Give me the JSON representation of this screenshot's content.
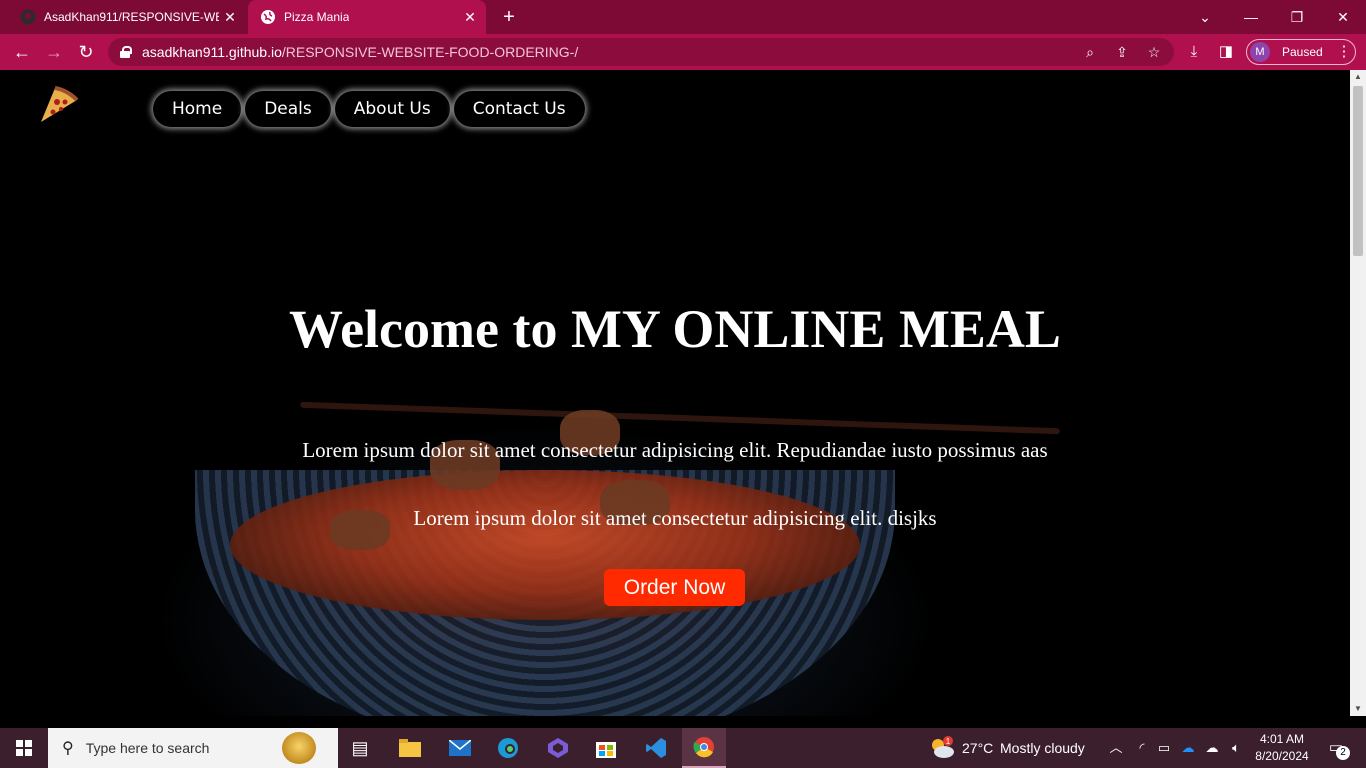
{
  "browser": {
    "tabs": [
      {
        "title": "AsadKhan911/RESPONSIVE-WEB",
        "favicon": "github-icon"
      },
      {
        "title": "Pizza Mania",
        "favicon": "globe-icon",
        "active": true
      }
    ],
    "url_host": "asadkhan911.github.io",
    "url_path": "/RESPONSIVE-WEBSITE-FOOD-ORDERING-/",
    "profile_initial": "M",
    "profile_status": "Paused",
    "accent_color": "#b1104f",
    "tabbar_color": "#7d0a35"
  },
  "page": {
    "nav": [
      "Home",
      "Deals",
      "About Us",
      "Contact Us"
    ],
    "title": "Welcome to MY ONLINE MEAL",
    "paragraph1": "Lorem ipsum dolor sit amet consectetur adipisicing elit. Repudiandae iusto possimus aas",
    "paragraph2": "Lorem ipsum dolor sit amet consectetur adipisicing elit. disjks",
    "cta": "Order Now",
    "cta_color": "#ff2a00",
    "logo": "pizza-slice-icon"
  },
  "taskbar": {
    "search_placeholder": "Type here to search",
    "weather_temp": "27°C",
    "weather_desc": "Mostly cloudy",
    "weather_badge": "1",
    "time": "4:01 AM",
    "date": "8/20/2024",
    "notification_count": "2"
  }
}
